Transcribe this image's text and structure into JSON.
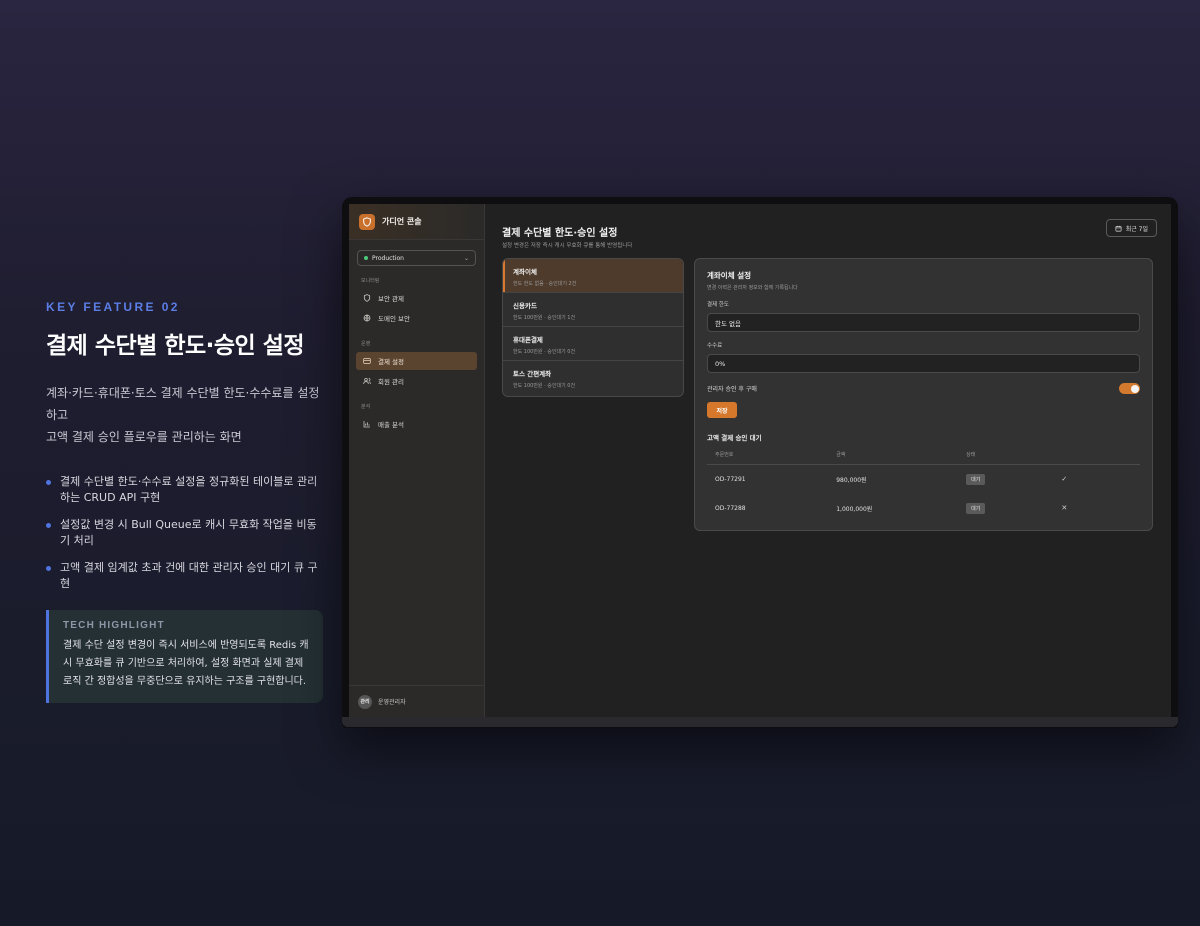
{
  "promo": {
    "eyebrow": "KEY FEATURE 02",
    "title": "결제 수단별 한도·승인 설정",
    "desc_line1": "계좌·카드·휴대폰·토스 결제 수단별 한도·수수료를 설정하고",
    "desc_line2": "고액 결제 승인 플로우를 관리하는 화면",
    "bullets": [
      "결제 수단별 한도·수수료 설정을 정규화된 테이블로 관리하는 CRUD API 구현",
      "설정값 변경 시 Bull Queue로 캐시 무효화 작업을 비동기 처리",
      "고액 결제 임계값 초과 건에 대한 관리자 승인 대기 큐 구현"
    ],
    "tech_label": "TECH HIGHLIGHT",
    "tech_body": "결제 수단 설정 변경이 즉시 서비스에 반영되도록 Redis 캐시 무효화를 큐 기반으로 처리하여, 설정 화면과 실제 결제 로직 간 정합성을 무중단으로 유지하는 구조를 구현합니다."
  },
  "app": {
    "brand": "가디언 콘솔",
    "env": "Production",
    "sections": {
      "monitoring": "모니터링",
      "operations": "운영",
      "analytics": "분석"
    },
    "nav": {
      "security_control": "보안 관제",
      "domain_security": "도메인 보안",
      "payment_settings": "결제 설정",
      "member_management": "회원 관리",
      "sales_analytics": "매출 분석"
    },
    "user": {
      "avatar": "관리",
      "name": "운영관리자"
    },
    "header": {
      "title": "결제 수단별 한도·승인 설정",
      "subtitle": "설정 변경은 저장 즉시 캐시 무효화 큐를 통해 반영됩니다",
      "date_range": "최근 7일"
    },
    "methods": [
      {
        "name": "계좌이체",
        "meta": "한도 한도 없음 · 승인대기 2건"
      },
      {
        "name": "신용카드",
        "meta": "한도 100만원 · 승인대기 1건"
      },
      {
        "name": "휴대폰결제",
        "meta": "한도 100만원 · 승인대기 0건"
      },
      {
        "name": "토스 간편계좌",
        "meta": "한도 100만원 · 승인대기 0건"
      }
    ],
    "panel": {
      "title": "계좌이체 설정",
      "subtitle": "변경 이력은 관리자 정보와 함께 기록됩니다",
      "limit_label": "결제 한도",
      "limit_value": "한도 없음",
      "fee_label": "수수료",
      "fee_value": "0%",
      "approval_label": "관리자 승인 후 구매",
      "approval_enabled": true,
      "save_label": "저장",
      "queue_title": "고액 결제 승인 대기",
      "columns": [
        "주문번호",
        "금액",
        "상태",
        ""
      ],
      "rows": [
        {
          "order": "OD-77291",
          "amount": "980,000원",
          "status": "대기",
          "action": "✓"
        },
        {
          "order": "OD-77288",
          "amount": "1,000,000원",
          "status": "대기",
          "action": "✕"
        }
      ]
    }
  },
  "colors": {
    "accent": "#d6782b",
    "highlight_blue": "#4f74e0",
    "env_live": "#4ec97a"
  }
}
